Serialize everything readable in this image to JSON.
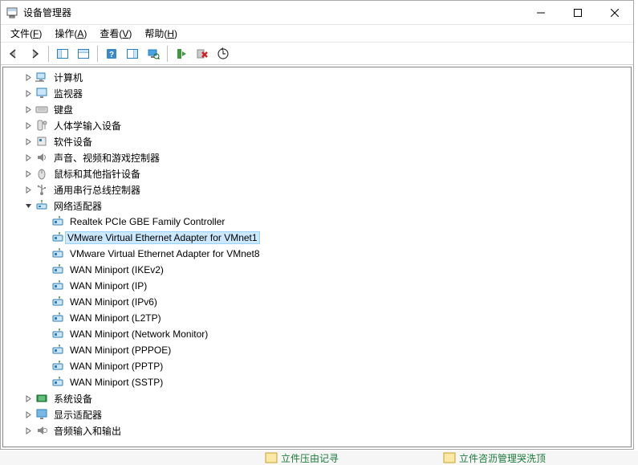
{
  "window": {
    "title": "设备管理器"
  },
  "menu": {
    "file": "文件(F)",
    "action": "操作(A)",
    "view": "查看(V)",
    "help": "帮助(H)"
  },
  "tree": [
    {
      "indent": 1,
      "expander": "right",
      "icon": "computer",
      "label": "计算机"
    },
    {
      "indent": 1,
      "expander": "right",
      "icon": "monitor",
      "label": "监视器"
    },
    {
      "indent": 1,
      "expander": "right",
      "icon": "keyboard",
      "label": "键盘"
    },
    {
      "indent": 1,
      "expander": "right",
      "icon": "hid",
      "label": "人体学输入设备"
    },
    {
      "indent": 1,
      "expander": "right",
      "icon": "software",
      "label": "软件设备"
    },
    {
      "indent": 1,
      "expander": "right",
      "icon": "sound",
      "label": "声音、视频和游戏控制器"
    },
    {
      "indent": 1,
      "expander": "right",
      "icon": "mouse",
      "label": "鼠标和其他指针设备"
    },
    {
      "indent": 1,
      "expander": "right",
      "icon": "usb",
      "label": "通用串行总线控制器"
    },
    {
      "indent": 1,
      "expander": "down",
      "icon": "network",
      "label": "网络适配器"
    },
    {
      "indent": 2,
      "expander": "",
      "icon": "netcard",
      "label": "Realtek PCIe GBE Family Controller"
    },
    {
      "indent": 2,
      "expander": "",
      "icon": "netcard",
      "label": "VMware Virtual Ethernet Adapter for VMnet1",
      "selected": true
    },
    {
      "indent": 2,
      "expander": "",
      "icon": "netcard",
      "label": "VMware Virtual Ethernet Adapter for VMnet8"
    },
    {
      "indent": 2,
      "expander": "",
      "icon": "netcard",
      "label": "WAN Miniport (IKEv2)"
    },
    {
      "indent": 2,
      "expander": "",
      "icon": "netcard",
      "label": "WAN Miniport (IP)"
    },
    {
      "indent": 2,
      "expander": "",
      "icon": "netcard",
      "label": "WAN Miniport (IPv6)"
    },
    {
      "indent": 2,
      "expander": "",
      "icon": "netcard",
      "label": "WAN Miniport (L2TP)"
    },
    {
      "indent": 2,
      "expander": "",
      "icon": "netcard",
      "label": "WAN Miniport (Network Monitor)"
    },
    {
      "indent": 2,
      "expander": "",
      "icon": "netcard",
      "label": "WAN Miniport (PPPOE)"
    },
    {
      "indent": 2,
      "expander": "",
      "icon": "netcard",
      "label": "WAN Miniport (PPTP)"
    },
    {
      "indent": 2,
      "expander": "",
      "icon": "netcard",
      "label": "WAN Miniport (SSTP)"
    },
    {
      "indent": 1,
      "expander": "right",
      "icon": "system",
      "label": "系统设备"
    },
    {
      "indent": 1,
      "expander": "right",
      "icon": "display",
      "label": "显示适配器"
    },
    {
      "indent": 1,
      "expander": "right",
      "icon": "audio",
      "label": "音频输入和输出"
    }
  ],
  "bottom": {
    "frag1": "立件压由记寻",
    "frag2": "立件咨沥管理哭洗顶"
  }
}
